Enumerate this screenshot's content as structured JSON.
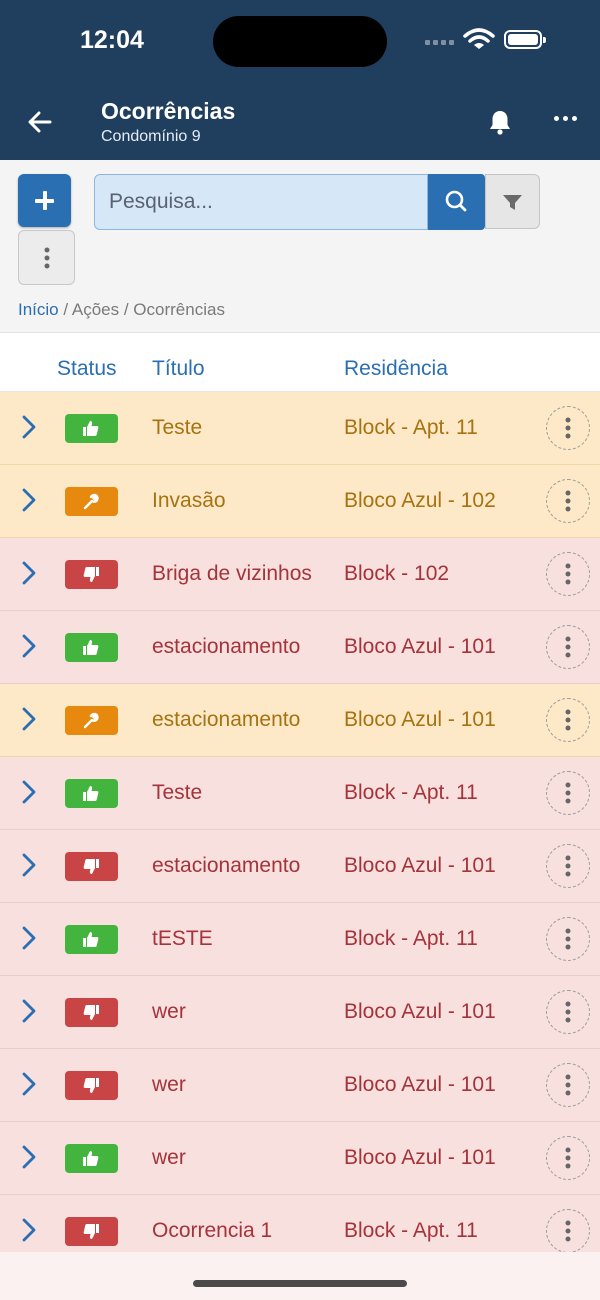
{
  "status_bar": {
    "time": "12:04"
  },
  "header": {
    "title": "Ocorrências",
    "subtitle": "Condomínio 9"
  },
  "toolbar": {
    "search_placeholder": "Pesquisa..."
  },
  "breadcrumb": {
    "home": "Início",
    "sep1": " / ",
    "actions": "Ações",
    "sep2": " / ",
    "current": "Ocorrências"
  },
  "table": {
    "headers": {
      "status": "Status",
      "title": "Título",
      "residence": "Residência"
    },
    "rows": [
      {
        "title": "Teste",
        "residence": "Block - Apt. 11",
        "status": "approved",
        "tone": "warn"
      },
      {
        "title": "Invasão",
        "residence": "Bloco Azul - 102",
        "status": "in-progress",
        "tone": "warn"
      },
      {
        "title": "Briga de vizinhos",
        "residence": "Block - 102",
        "status": "rejected",
        "tone": "danger"
      },
      {
        "title": "estacionamento",
        "residence": "Bloco Azul - 101",
        "status": "approved",
        "tone": "danger"
      },
      {
        "title": "estacionamento",
        "residence": "Bloco Azul - 101",
        "status": "in-progress",
        "tone": "warn"
      },
      {
        "title": "Teste",
        "residence": "Block - Apt. 11",
        "status": "approved",
        "tone": "danger"
      },
      {
        "title": "estacionamento",
        "residence": "Bloco Azul - 101",
        "status": "rejected",
        "tone": "danger"
      },
      {
        "title": "tESTE",
        "residence": "Block - Apt. 11",
        "status": "approved",
        "tone": "danger"
      },
      {
        "title": "wer",
        "residence": "Bloco Azul - 101",
        "status": "rejected",
        "tone": "danger"
      },
      {
        "title": "wer",
        "residence": "Bloco Azul - 101",
        "status": "rejected",
        "tone": "danger"
      },
      {
        "title": "wer",
        "residence": "Bloco Azul - 101",
        "status": "approved",
        "tone": "danger"
      },
      {
        "title": "Ocorrencia 1",
        "residence": "Block - Apt. 11",
        "status": "rejected",
        "tone": "danger"
      }
    ]
  },
  "colors": {
    "header_bg": "#203e5e",
    "primary": "#2a6fb2",
    "approved": "#43b53f",
    "rejected": "#c94545",
    "in_progress": "#e8890f"
  }
}
